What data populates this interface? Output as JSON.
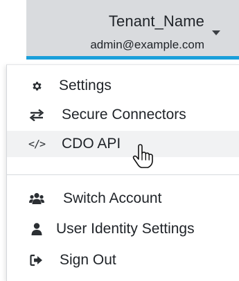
{
  "account": {
    "tenant_name": "Tenant_Name",
    "email": "admin@example.com"
  },
  "menu": {
    "items": [
      {
        "icon": "gear-icon",
        "label": "Settings"
      },
      {
        "icon": "arrows-exchange-icon",
        "label": "Secure Connectors"
      },
      {
        "icon": "code-icon",
        "icon_text": "</>",
        "label": "CDO API",
        "hovered": true
      },
      {
        "icon": "users-icon",
        "label": "Switch Account"
      },
      {
        "icon": "user-icon",
        "label": "User Identity Settings"
      },
      {
        "icon": "sign-out-icon",
        "label": "Sign Out"
      }
    ]
  },
  "colors": {
    "header_bg": "#d9dbde",
    "accent_underline": "#1a9fda",
    "hover_bg": "#f1f2f3",
    "text": "#1f2328"
  }
}
